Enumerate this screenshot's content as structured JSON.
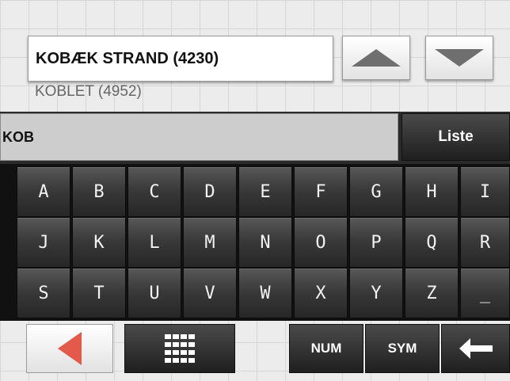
{
  "suggestions": {
    "selected": "KOBÆK STRAND (4230)",
    "next": "KOBLET (4952)"
  },
  "scroll": {
    "up_icon": "triangle-up-icon",
    "down_icon": "triangle-down-icon"
  },
  "input": {
    "value": "KOB",
    "list_label": "Liste"
  },
  "keyboard": {
    "rows": [
      [
        "A",
        "B",
        "C",
        "D",
        "E",
        "F",
        "G",
        "H",
        "I"
      ],
      [
        "J",
        "K",
        "L",
        "M",
        "N",
        "O",
        "P",
        "Q",
        "R"
      ],
      [
        "S",
        "T",
        "U",
        "V",
        "W",
        "X",
        "Y",
        "Z",
        "_"
      ]
    ]
  },
  "bottom": {
    "back_icon": "back-arrow-icon",
    "grid_icon": "keypad-grid-icon",
    "num_label": "NUM",
    "sym_label": "SYM",
    "backspace_icon": "backspace-arrow-icon",
    "accent_color": "#e35a4a"
  }
}
